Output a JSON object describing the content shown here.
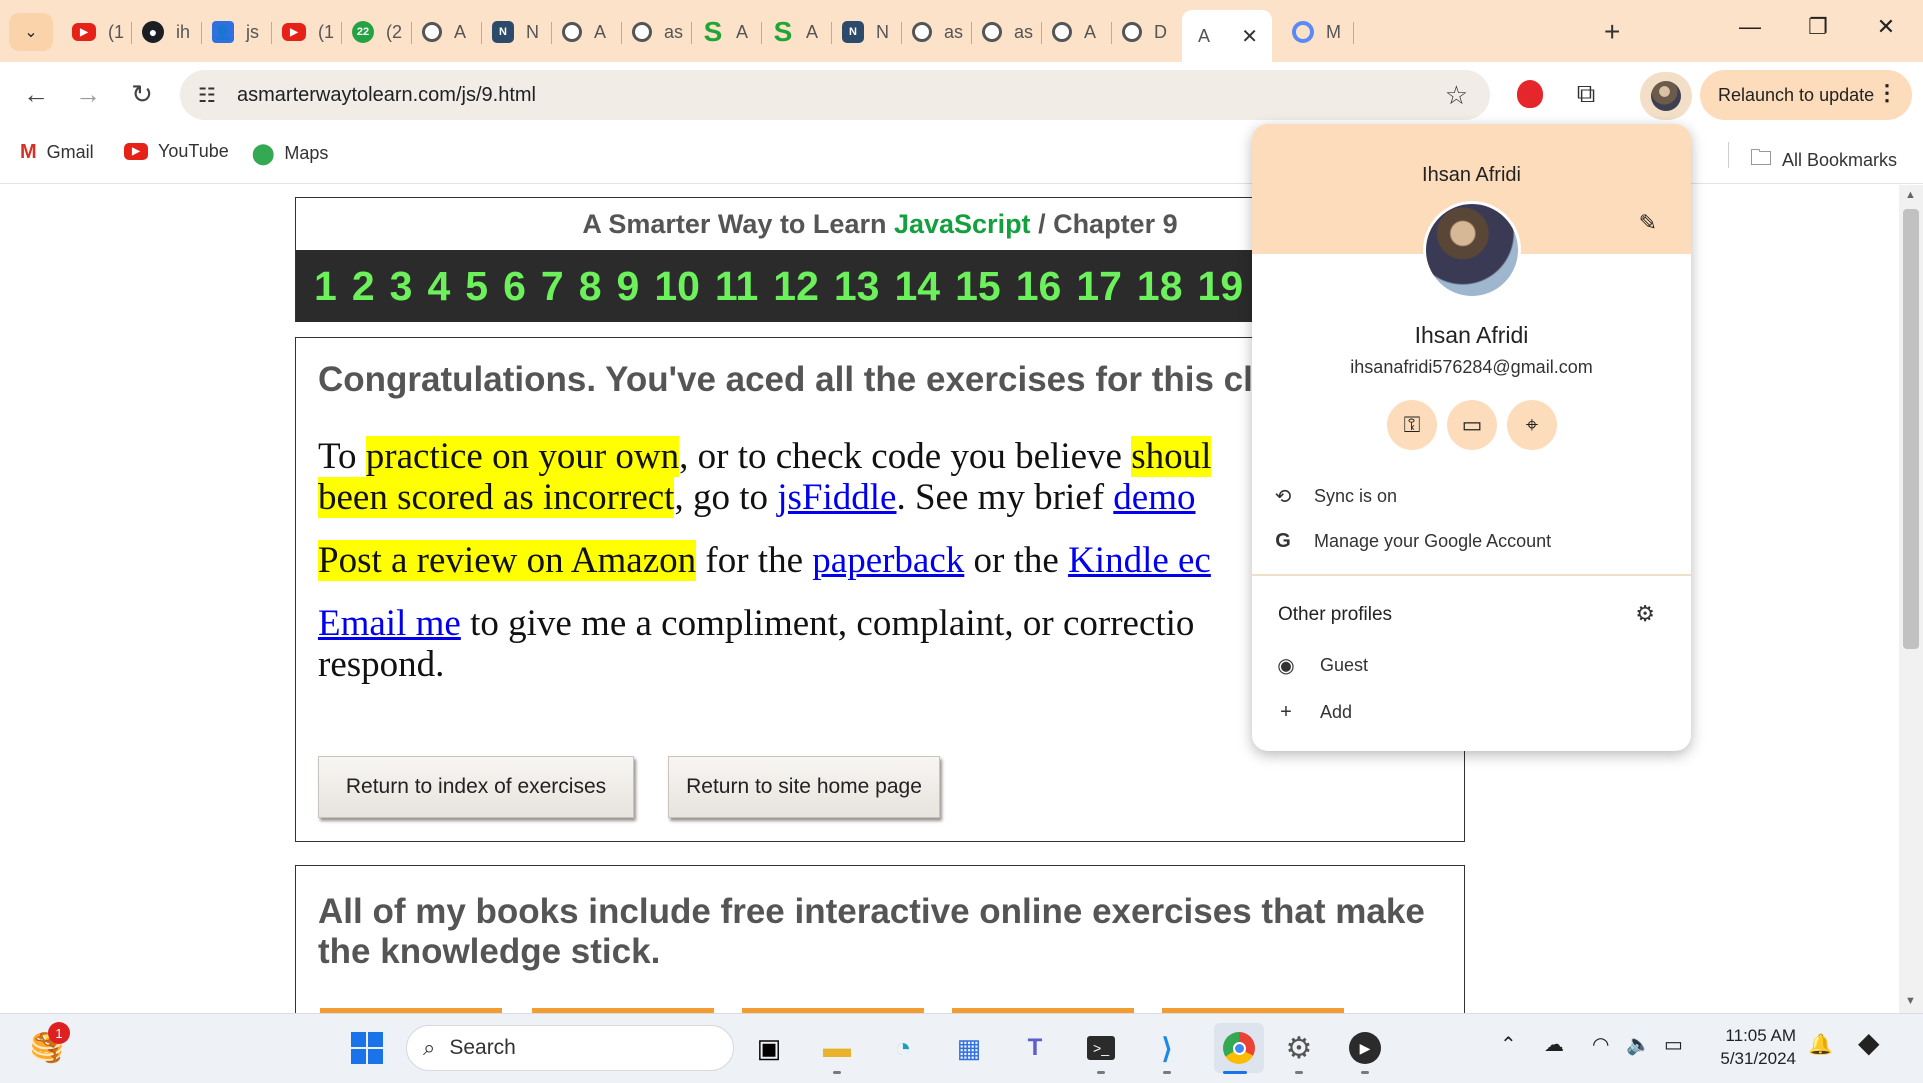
{
  "tabs": [
    {
      "icon": "youtube-icon",
      "label": "(1"
    },
    {
      "icon": "github-icon",
      "label": "ih"
    },
    {
      "icon": "contact-icon",
      "label": "js"
    },
    {
      "icon": "youtube-icon",
      "label": "(1"
    },
    {
      "icon": "whatsapp-icon",
      "label": "(2"
    },
    {
      "icon": "globe-icon",
      "label": "A"
    },
    {
      "icon": "notion-icon",
      "label": "N"
    },
    {
      "icon": "globe-icon",
      "label": "A"
    },
    {
      "icon": "globe-icon",
      "label": "as"
    },
    {
      "icon": "s-logo-icon",
      "label": "A"
    },
    {
      "icon": "s-logo-icon",
      "label": "A"
    },
    {
      "icon": "notion-icon",
      "label": "N"
    },
    {
      "icon": "globe-icon",
      "label": "as"
    },
    {
      "icon": "globe-icon",
      "label": "as"
    },
    {
      "icon": "globe-icon",
      "label": "A"
    },
    {
      "icon": "globe-icon",
      "label": "D"
    },
    {
      "icon": "",
      "label": "A",
      "active": true
    },
    {
      "icon": "ring-icon",
      "label": "M"
    }
  ],
  "tab_badges": {
    "whatsapp": "22"
  },
  "window_controls": {
    "minimize": "—",
    "restore": "❐",
    "close": "✕"
  },
  "address_bar": {
    "url": "asmarterwaytolearn.com/js/9.html"
  },
  "relaunch_label": "Relaunch to update",
  "bookmarks": [
    {
      "icon": "gmail-icon",
      "label": "Gmail"
    },
    {
      "icon": "youtube-icon",
      "label": "YouTube"
    },
    {
      "icon": "maps-icon",
      "label": "Maps"
    }
  ],
  "all_bookmarks_label": "All Bookmarks",
  "page": {
    "header_prefix": "A Smarter Way to Learn ",
    "header_js": "JavaScript",
    "header_suffix": "  /  Chapter 9",
    "chapters": [
      "1",
      "2",
      "3",
      "4",
      "5",
      "6",
      "7",
      "8",
      "9",
      "10",
      "11",
      "12",
      "13",
      "14",
      "15",
      "16",
      "17",
      "18",
      "19"
    ],
    "congrats": "Congratulations. You've aced all the exercises for this cl",
    "p1_hl1": "practice on your own",
    "p1_t1": "To ",
    "p1_t2": ", or to check code you believe ",
    "p1_hl2": "shoul",
    "p1_hl3": "been scored as incorrect",
    "p1_t3": ", go to ",
    "p1_link1": "jsFiddle",
    "p1_t4": ". See my brief ",
    "p1_link2": "demo",
    "p2_hl": "Post a review on Amazon",
    "p2_t1": " for the ",
    "p2_link1": "paperback",
    "p2_t2": " or the ",
    "p2_link2": "Kindle ec",
    "p3_link": "Email me",
    "p3_t1": " to give me a compliment, complaint, or correctio",
    "p3_t2": "respond.",
    "btn_index": "Return to index of exercises",
    "btn_home": "Return to site home page",
    "books_text": "  All of my books include free interactive online exercises that make the knowledge stick."
  },
  "profile_popup": {
    "top_name": "Ihsan Afridi",
    "name": "Ihsan Afridi",
    "email": "ihsanafridi576284@gmail.com",
    "sync_label": "Sync is on",
    "manage_label": "Manage your Google Account",
    "other_profiles_label": "Other profiles",
    "guest_label": "Guest",
    "add_label": "Add"
  },
  "taskbar": {
    "search_placeholder": "Search",
    "notification_count": "1",
    "time": "11:05 AM",
    "date": "5/31/2024"
  },
  "colors": {
    "tabstrip": "#fce2c8",
    "chapter_bar": "#2b2b2b",
    "chapter_numbers": "#6cf05b",
    "highlight": "#ffff00",
    "link": "#0000ee",
    "javascript_green": "#15a040"
  }
}
